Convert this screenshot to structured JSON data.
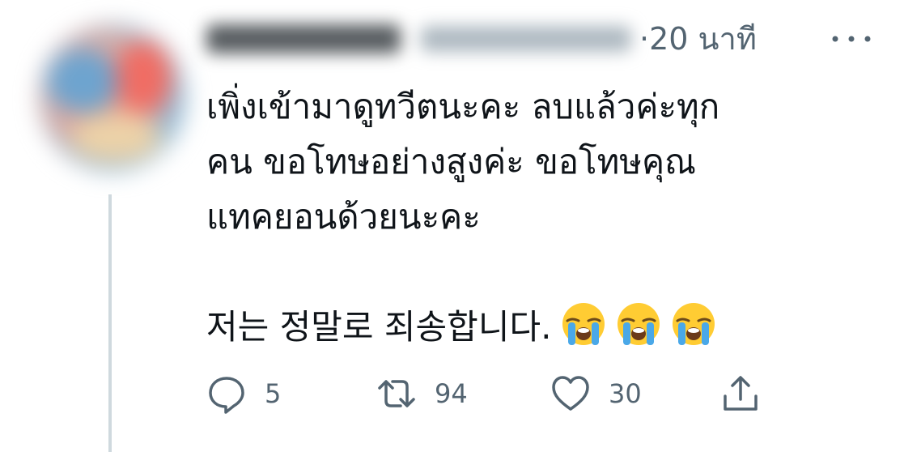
{
  "tweet": {
    "time": "·20 นาที",
    "text_line1": "เพิ่งเข้ามาดูทวีตนะคะ ลบแล้วค่ะทุก",
    "text_line2": "คน ขอโทษอย่างสูงค่ะ ขอโทษคุณ",
    "text_line3": "แทคยอนด้วยนะคะ",
    "text_korean": "저는 정말로 죄송합니다.",
    "emoji": [
      "loudly-crying-face",
      "loudly-crying-face",
      "loudly-crying-face"
    ]
  },
  "actions": {
    "reply_count": "5",
    "retweet_count": "94",
    "like_count": "30"
  },
  "colors": {
    "text": "#0f1419",
    "secondary": "#536471",
    "thread_line": "#cfd9de"
  },
  "icons": {
    "more": "more-horizontal-icon",
    "reply": "reply-icon",
    "retweet": "retweet-icon",
    "like": "heart-icon",
    "share": "share-icon"
  }
}
